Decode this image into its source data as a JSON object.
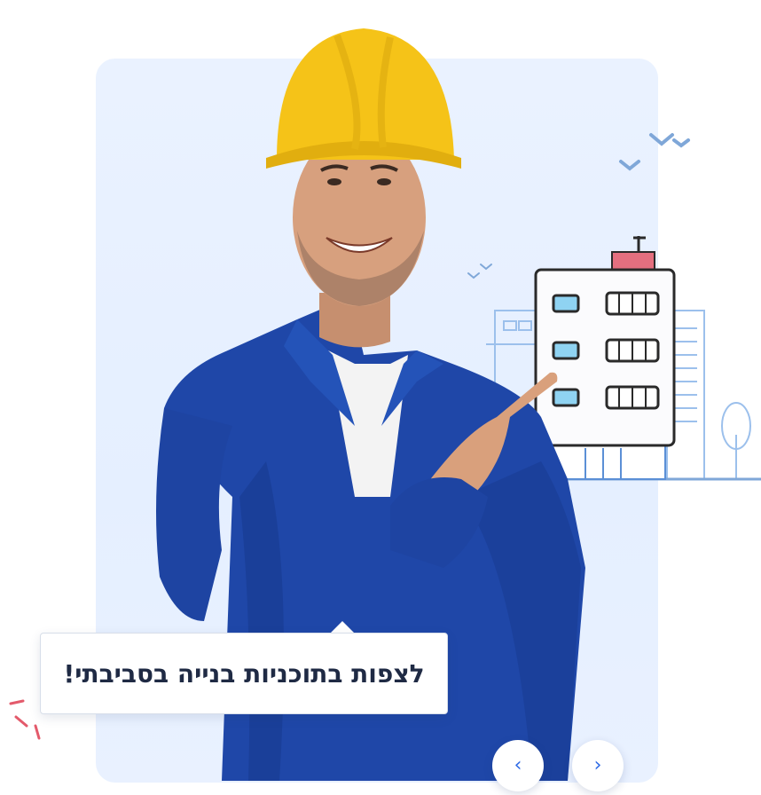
{
  "promo": {
    "caption": "לצפות בתוכניות בנייה בסביבתי!"
  },
  "carousel": {
    "prev_icon": "chevron-left-icon",
    "next_icon": "chevron-right-icon",
    "prev_glyph": "‹",
    "next_glyph": "›"
  },
  "colors": {
    "card_background": "#e8f0ff",
    "helmet": "#f5c318",
    "coverall": "#1f47a8",
    "accent_blue": "#2f6be6",
    "caption_text": "#1f2a44"
  }
}
